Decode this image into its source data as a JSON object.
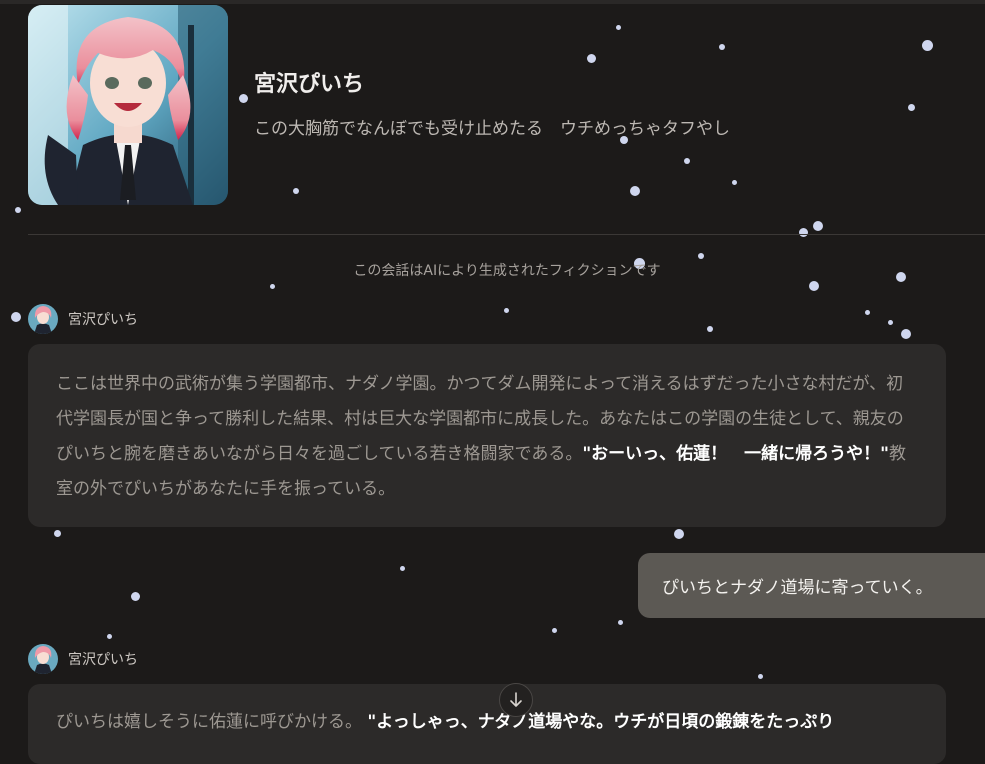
{
  "character": {
    "name": "宮沢ぴいち",
    "tagline": "この大胸筋でなんぼでも受け止めたる　ウチめっちゃタフやし"
  },
  "disclaimer": "この会話はAIにより生成されたフィクションです",
  "messages": [
    {
      "sender": "宮沢ぴいち",
      "parts": [
        {
          "text": "ここは世界中の武術が集う学園都市、ナダノ学園。かつてダム開発によって消えるはずだった小さな村だが、初代学園長が国と争って勝利した結果、村は巨大な学園都市に成長した。あなたはこの学園の生徒として、親友のぴいちと腕を磨きあいながら日々を過ごしている若き格闘家である。"
        },
        {
          "bold": "\"おーいっ、佑蓮！　一緒に帰ろうや！\""
        },
        {
          "text2": "教室の外でぴいちがあなたに手を振っている。"
        }
      ]
    },
    {
      "user_text": "ぴいちとナダノ道場に寄っていく。"
    },
    {
      "sender": "宮沢ぴいち",
      "parts": [
        {
          "text": "ぴいちは嬉しそうに佑蓮に呼びかける。"
        },
        {
          "bold": "\"よっしゃっ、ナダノ道場やな。ウチが日頃の鍛錬をたっぷり"
        }
      ]
    }
  ],
  "icons": {
    "scroll_down": "arrow-down-icon",
    "avatar": "character-avatar-image"
  }
}
